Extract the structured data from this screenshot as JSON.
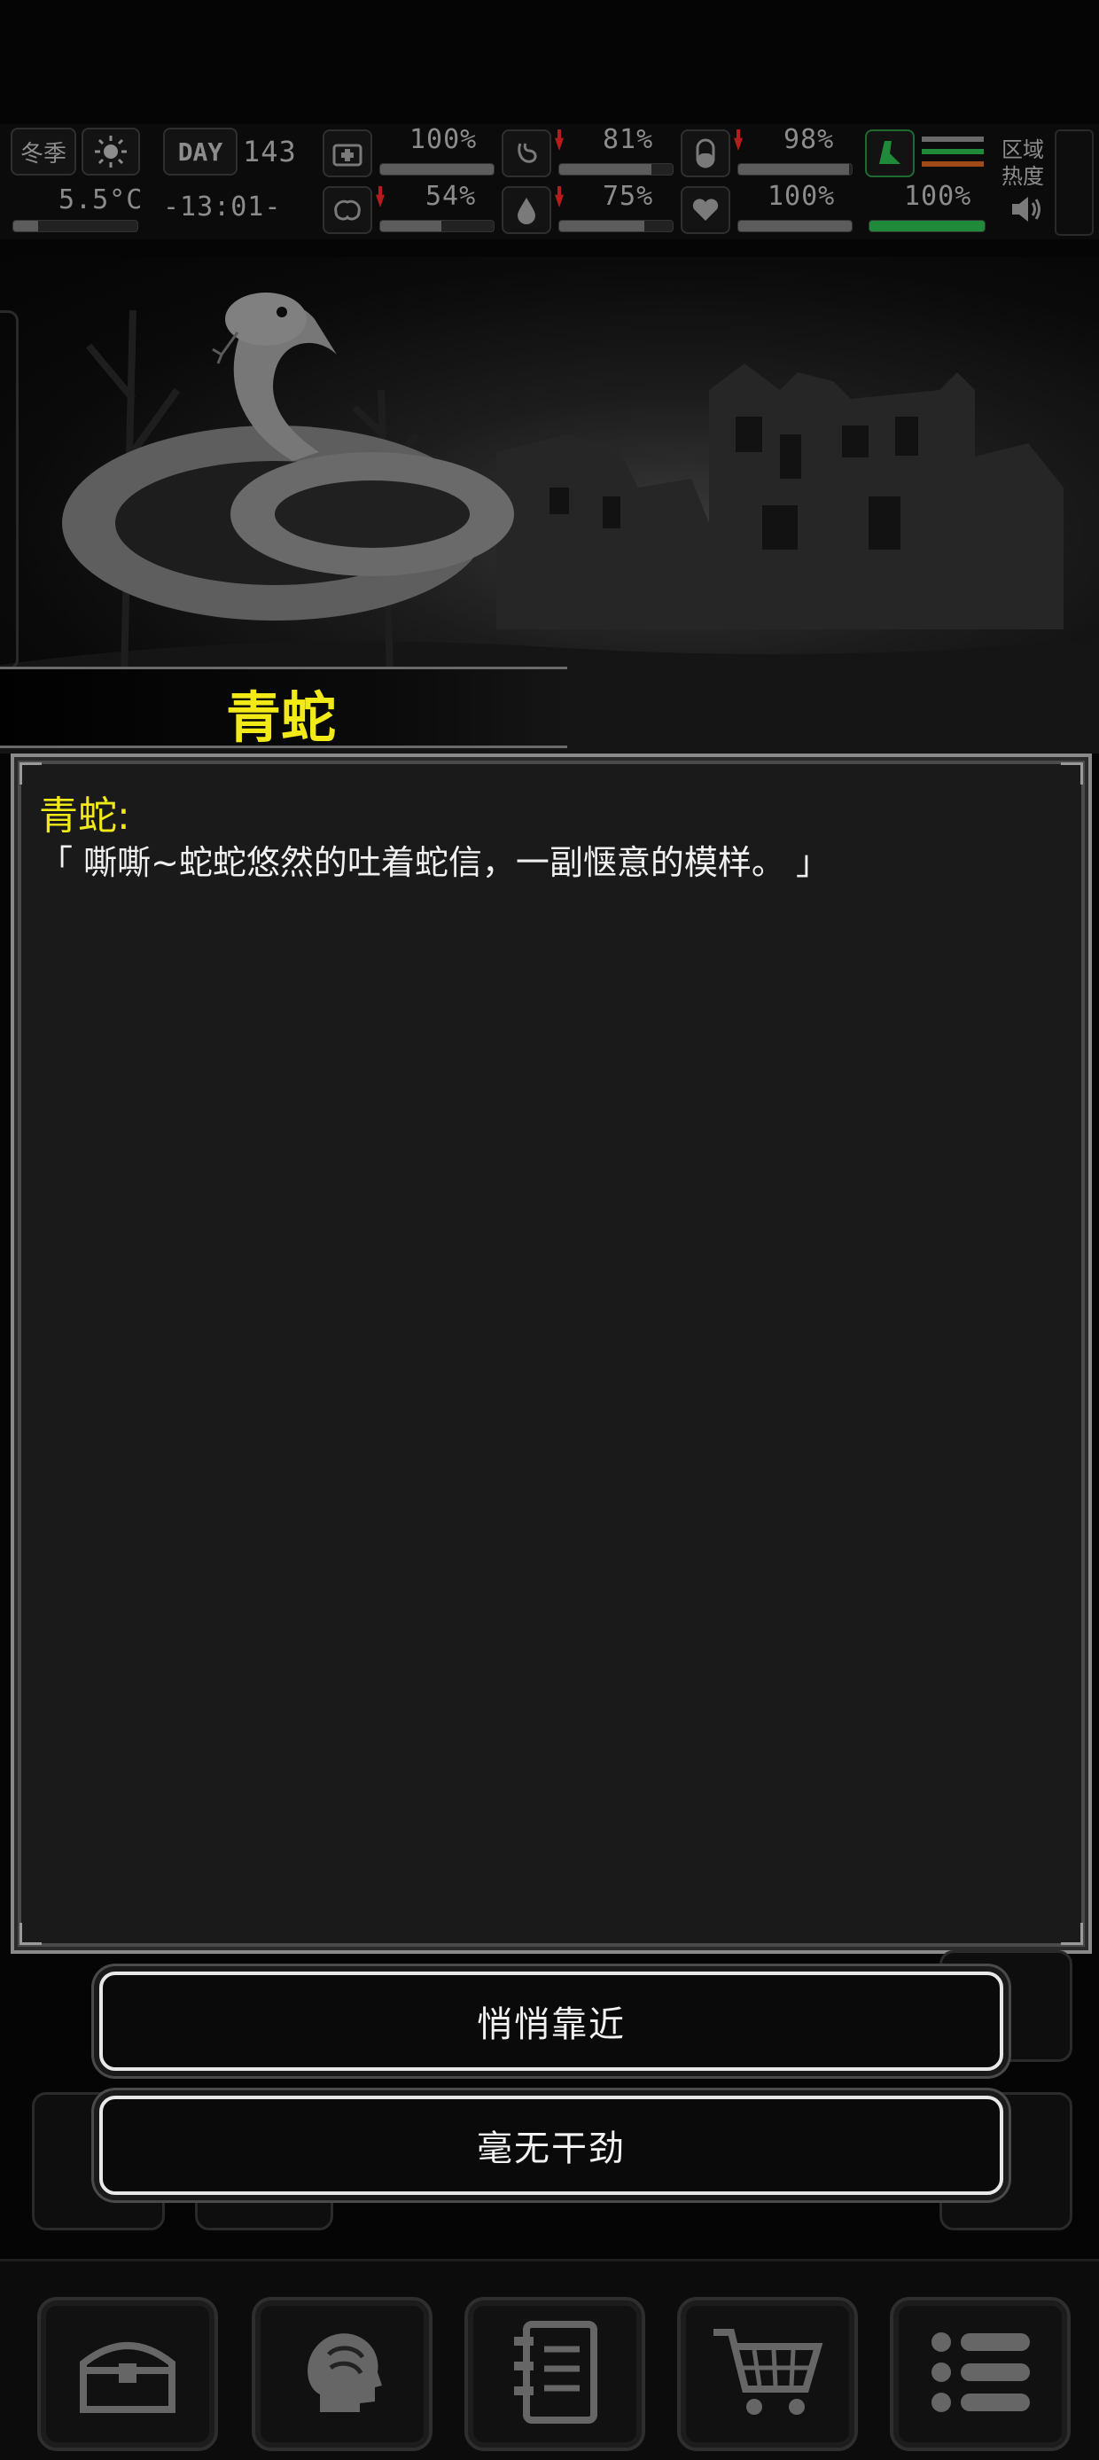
{
  "status": {
    "season": "冬季",
    "day_label": "DAY",
    "day_number": "143",
    "temperature": "5.5°C",
    "clock": "-13:01-",
    "stats": [
      {
        "icon": "first-aid-icon",
        "value": "100%",
        "fill": 1.0
      },
      {
        "icon": "stomach-icon",
        "value": "81%",
        "fill": 0.81
      },
      {
        "icon": "pill-icon",
        "value": "98%",
        "fill": 0.98
      },
      {
        "icon": "brain-icon",
        "value": "54%",
        "fill": 0.54
      },
      {
        "icon": "water-drop-icon",
        "value": "75%",
        "fill": 0.75
      },
      {
        "icon": "heart-icon",
        "value": "100%",
        "fill": 1.0
      },
      {
        "icon": "stamina-icon",
        "value": "100%",
        "fill": 1.0
      }
    ],
    "area_heat_label": "区域热度",
    "accent_yellow": "#f2ea17",
    "bar_green": "#1f8a3a"
  },
  "encounter": {
    "title": "青蛇",
    "speaker": "青蛇:",
    "text": "「 嘶嘶~蛇蛇悠然的吐着蛇信，一副惬意的模样。 」"
  },
  "choices": [
    {
      "label": "悄悄靠近"
    },
    {
      "label": "毫无干劲"
    }
  ],
  "bottom_nav": [
    {
      "icon": "treasure-chest-icon"
    },
    {
      "icon": "brain-head-icon"
    },
    {
      "icon": "notebook-icon"
    },
    {
      "icon": "shopping-cart-icon"
    },
    {
      "icon": "menu-list-icon"
    }
  ]
}
